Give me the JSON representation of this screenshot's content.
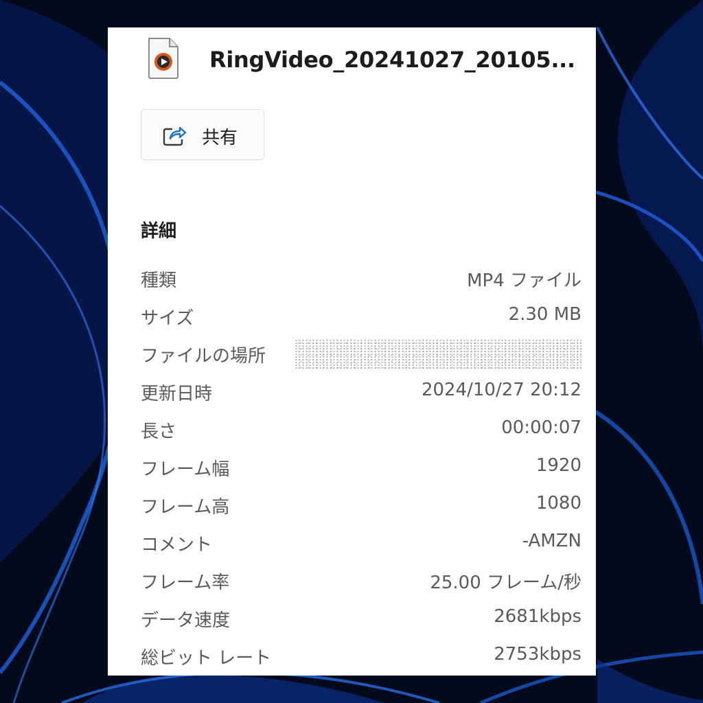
{
  "colors": {
    "desktop_background": "#030a1c",
    "wallpaper_accent": "#1e63e0",
    "panel_background": "#ffffff",
    "primary_text": "#1c1c1c",
    "secondary_text": "#5a5a5a",
    "file_icon_accent": "#d8561c",
    "share_icon_accent": "#1a73d9"
  },
  "file": {
    "icon": "video-file-icon",
    "name": "RingVideo_20241027_20105..."
  },
  "actions": {
    "share_icon": "share-icon",
    "share_label": "共有"
  },
  "details": {
    "title": "詳細",
    "rows": [
      {
        "label": "種類",
        "value": "MP4 ファイル"
      },
      {
        "label": "サイズ",
        "value": "2.30 MB"
      },
      {
        "label": "ファイルの場所",
        "value": "",
        "redacted": true
      },
      {
        "label": "更新日時",
        "value": "2024/10/27 20:12"
      },
      {
        "label": "長さ",
        "value": "00:00:07"
      },
      {
        "label": "フレーム幅",
        "value": "1920"
      },
      {
        "label": "フレーム高",
        "value": "1080"
      },
      {
        "label": "コメント",
        "value": "-AMZN"
      },
      {
        "label": "フレーム率",
        "value": "25.00 フレーム/秒"
      },
      {
        "label": "データ速度",
        "value": "2681kbps"
      },
      {
        "label": "総ビット レート",
        "value": "2753kbps"
      }
    ]
  }
}
